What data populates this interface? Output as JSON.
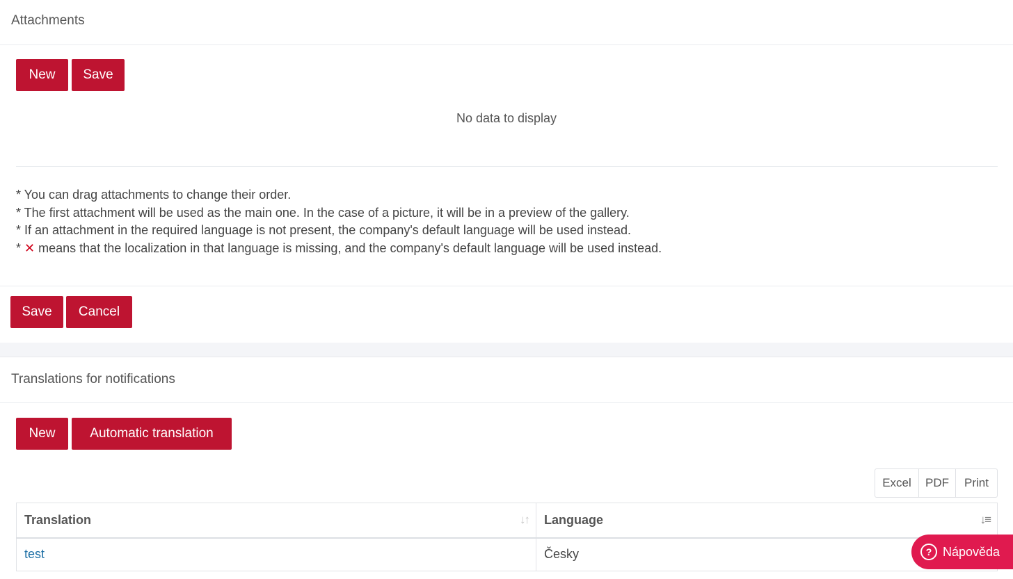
{
  "attachments": {
    "title": "Attachments",
    "new_label": "New",
    "save_label": "Save",
    "empty_text": "No data to display",
    "notes": [
      "* You can drag attachments to change their order.",
      "* The first attachment will be used as the main one. In the case of a picture, it will be in a preview of the gallery.",
      "* If an attachment in the required language is not present, the company's default language will be used instead."
    ],
    "note_missing_prefix": "*",
    "note_missing_icon": "✕",
    "note_missing_text": "means that the localization in that language is missing, and the company's default language will be used instead."
  },
  "form_actions": {
    "save_label": "Save",
    "cancel_label": "Cancel"
  },
  "translations": {
    "title": "Translations for notifications",
    "new_label": "New",
    "auto_label": "Automatic translation",
    "export": [
      "Excel",
      "PDF",
      "Print"
    ],
    "columns": [
      "Translation",
      "Language"
    ],
    "rows": [
      {
        "translation": "test",
        "language": "Česky"
      }
    ]
  },
  "help": {
    "label": "Nápověda",
    "icon": "question-circle-icon"
  },
  "colors": {
    "accent": "#be1431",
    "help": "#e01a4f",
    "link": "#1d6fa5"
  }
}
